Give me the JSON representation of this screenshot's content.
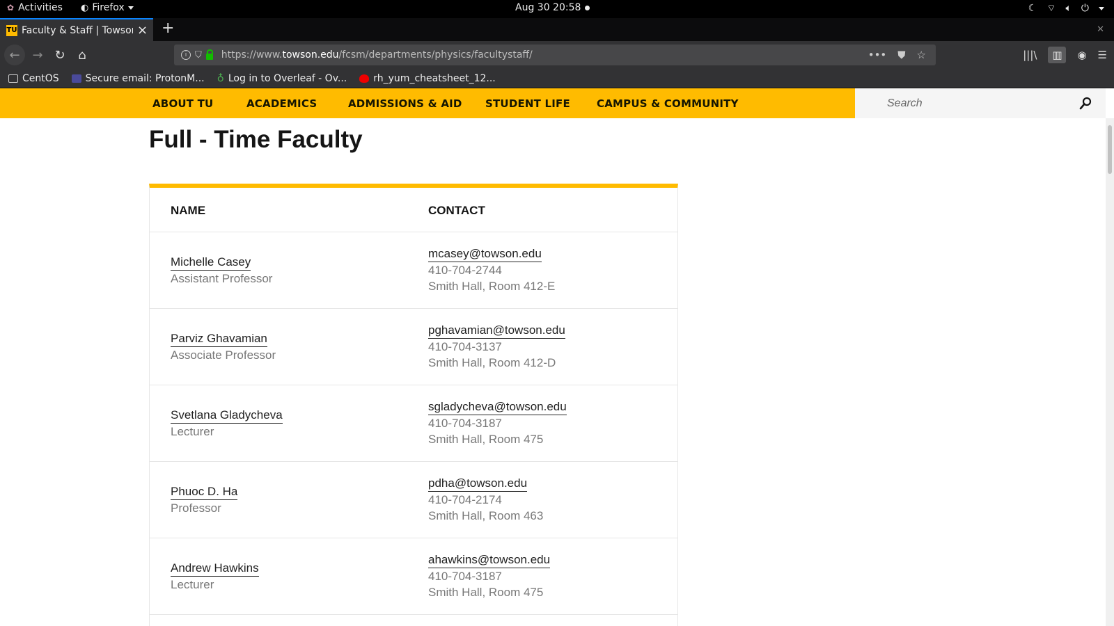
{
  "system": {
    "activities": "Activities",
    "app_name": "Firefox",
    "clock": "Aug 30  20:58"
  },
  "browser": {
    "tab_title": "Faculty & Staff | Towson",
    "tab_favicon": "TU",
    "url_prefix": "https://www.",
    "url_domain": "towson.edu",
    "url_path": "/fcsm/departments/physics/facultystaff/",
    "bookmarks": [
      {
        "label": "CentOS",
        "icon": "folder-icon"
      },
      {
        "label": "Secure email: ProtonM...",
        "icon": "protonmail-icon"
      },
      {
        "label": "Log in to Overleaf - Ov...",
        "icon": "overleaf-icon"
      },
      {
        "label": "rh_yum_cheatsheet_12...",
        "icon": "redhat-icon"
      }
    ]
  },
  "site": {
    "nav": [
      "ABOUT TU",
      "ACADEMICS",
      "ADMISSIONS & AID",
      "STUDENT LIFE",
      "CAMPUS & COMMUNITY"
    ],
    "search_placeholder": "Search",
    "brand_color": "#ffbb00"
  },
  "main": {
    "heading": "Full - Time Faculty",
    "table": {
      "headers": {
        "name": "NAME",
        "contact": "CONTACT"
      },
      "rows": [
        {
          "name": "Michelle Casey",
          "role": "Assistant Professor",
          "email": "mcasey@towson.edu",
          "phone": "410-704-2744",
          "office": "Smith Hall, Room 412-E"
        },
        {
          "name": "Parviz Ghavamian",
          "role": "Associate Professor",
          "email": "pghavamian@towson.edu",
          "phone": "410-704-3137",
          "office": "Smith Hall, Room 412-D"
        },
        {
          "name": "Svetlana Gladycheva",
          "role": "Lecturer",
          "email": "sgladycheva@towson.edu",
          "phone": "410-704-3187",
          "office": "Smith Hall, Room 475"
        },
        {
          "name": "Phuoc D. Ha",
          "role": "Professor",
          "email": "pdha@towson.edu",
          "phone": "410-704-2174",
          "office": "Smith Hall, Room 463"
        },
        {
          "name": "Andrew Hawkins",
          "role": "Lecturer",
          "email": "ahawkins@towson.edu",
          "phone": "410-704-3187",
          "office": "Smith Hall, Room 475"
        }
      ]
    }
  }
}
